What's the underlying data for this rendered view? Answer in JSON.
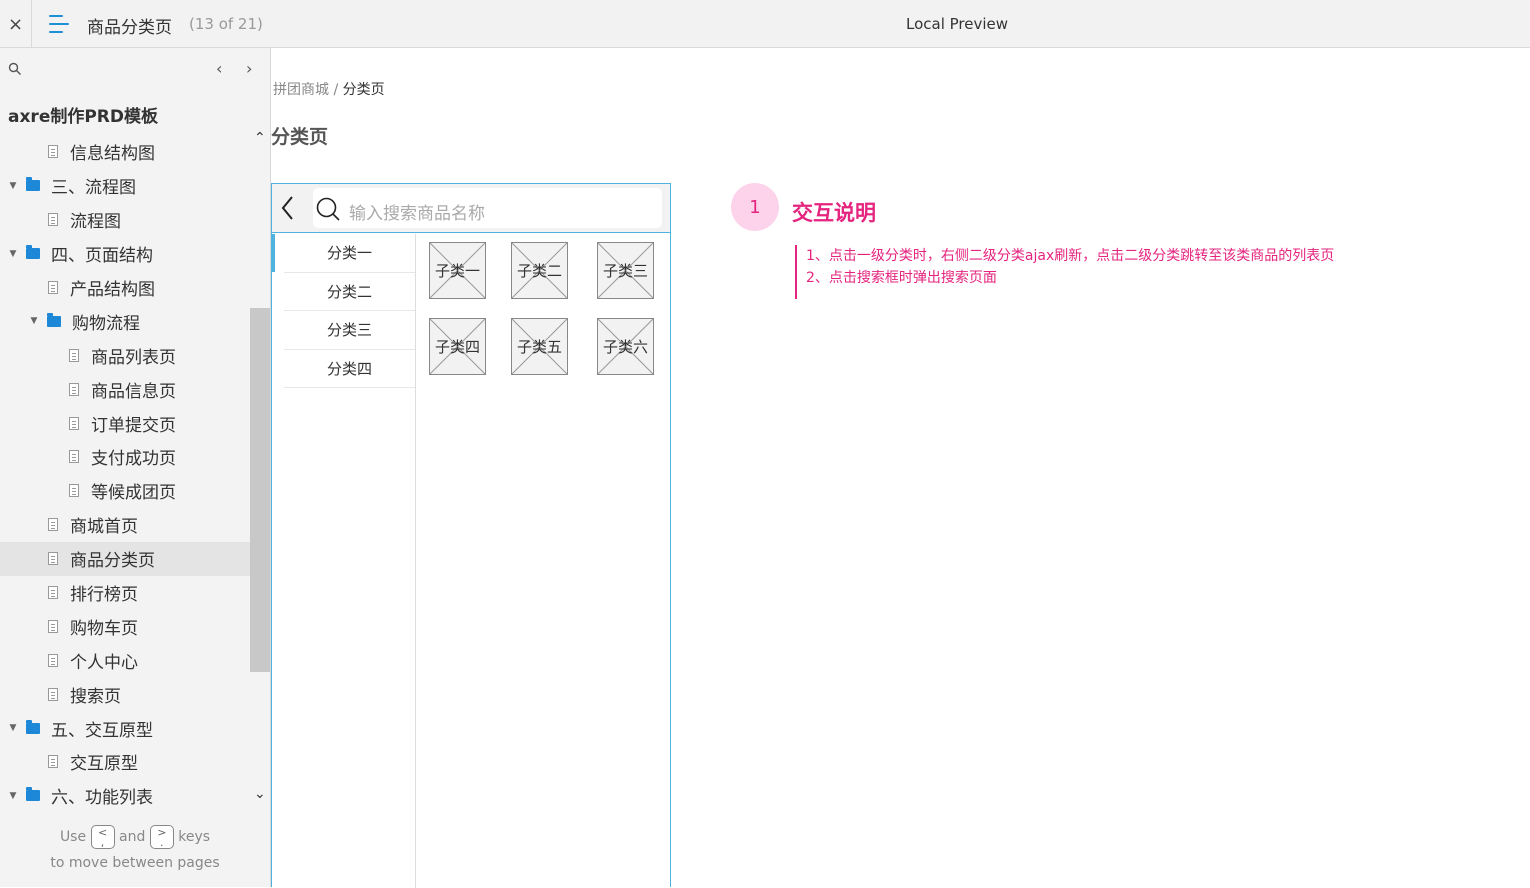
{
  "topbar": {
    "close_label": "×",
    "page_title": "商品分类页",
    "page_count": "(13 of 21)",
    "preview_label": "Local Preview"
  },
  "sidebar": {
    "prev_label": "‹",
    "next_label": "›",
    "project_title": "axre制作PRD模板",
    "items": [
      {
        "label": "信息结构图",
        "type": "page",
        "level": 2
      },
      {
        "label": "三、流程图",
        "type": "folder",
        "level": 1
      },
      {
        "label": "流程图",
        "type": "page",
        "level": 2
      },
      {
        "label": "四、页面结构",
        "type": "folder",
        "level": 1
      },
      {
        "label": "产品结构图",
        "type": "page",
        "level": 2
      },
      {
        "label": "购物流程",
        "type": "folder",
        "level": 2
      },
      {
        "label": "商品列表页",
        "type": "page",
        "level": 3
      },
      {
        "label": "商品信息页",
        "type": "page",
        "level": 3
      },
      {
        "label": "订单提交页",
        "type": "page",
        "level": 3
      },
      {
        "label": "支付成功页",
        "type": "page",
        "level": 3
      },
      {
        "label": "等候成团页",
        "type": "page",
        "level": 3
      },
      {
        "label": "商城首页",
        "type": "page",
        "level": 2
      },
      {
        "label": "商品分类页",
        "type": "page",
        "level": 2,
        "selected": true
      },
      {
        "label": "排行榜页",
        "type": "page",
        "level": 2
      },
      {
        "label": "购物车页",
        "type": "page",
        "level": 2
      },
      {
        "label": "个人中心",
        "type": "page",
        "level": 2
      },
      {
        "label": "搜索页",
        "type": "page",
        "level": 2
      },
      {
        "label": "五、交互原型",
        "type": "folder",
        "level": 1
      },
      {
        "label": "交互原型",
        "type": "page",
        "level": 2
      },
      {
        "label": "六、功能列表",
        "type": "folder",
        "level": 1
      }
    ],
    "hint": {
      "use": "Use",
      "and": "and",
      "keys": "keys",
      "line2": "to move between pages",
      "key_prev": "<\n,",
      "key_next": ">\n."
    }
  },
  "main": {
    "breadcrumb_parent": "拼团商城",
    "breadcrumb_sep": "/",
    "breadcrumb_current": "分类页",
    "title": "分类页"
  },
  "phone": {
    "search_placeholder": "输入搜索商品名称",
    "categories": [
      "分类一",
      "分类二",
      "分类三",
      "分类四"
    ],
    "subcategories": [
      "子类一",
      "子类二",
      "子类三",
      "子类四",
      "子类五",
      "子类六"
    ]
  },
  "annotation": {
    "badge": "1",
    "title": "交互说明",
    "lines": [
      "1、点击一级分类时，右侧二级分类ajax刷新，点击二级分类跳转至该类商品的列表页",
      "2、点击搜索框时弹出搜索页面"
    ]
  },
  "colors": {
    "accent_blue": "#1e88d8",
    "annotation_pink": "#e5247f",
    "phone_border": "#4fb3e0"
  }
}
